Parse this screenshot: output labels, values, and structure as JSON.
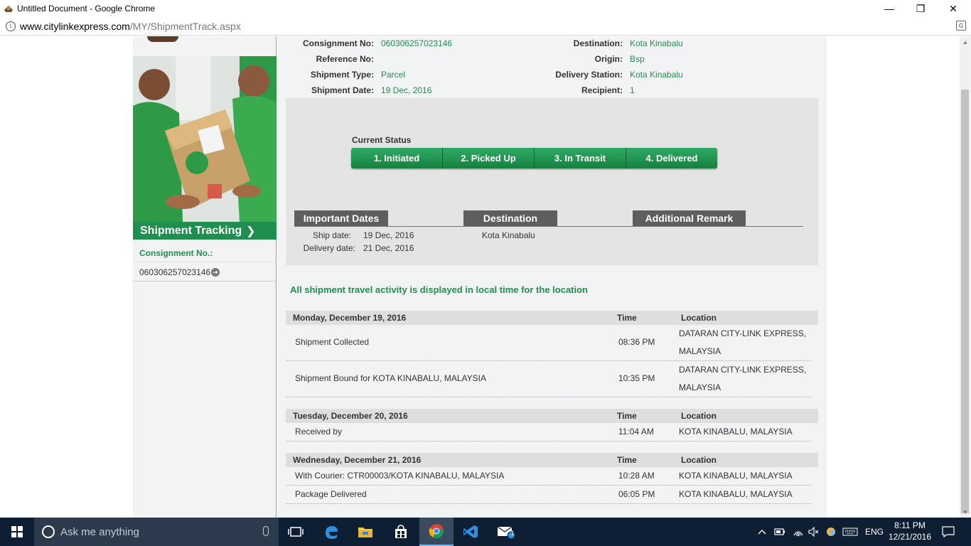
{
  "window": {
    "title": "Untitled Document - Google Chrome",
    "url_host": "www.citylinkexpress.com",
    "url_path": "/MY/ShipmentTrack.aspx"
  },
  "sidebar": {
    "banner_label": "Shipment Tracking",
    "consignment_label": "Consignment No.:",
    "consignment_value": "060306257023146"
  },
  "shipment": {
    "consignment_label": "Consignment No:",
    "consignment_value": "060306257023146",
    "reference_label": "Reference No:",
    "reference_value": "",
    "type_label": "Shipment Type:",
    "type_value": "Parcel",
    "date_label": "Shipment Date:",
    "date_value": "19 Dec, 2016",
    "destination_label": "Destination:",
    "destination_value": "Kota Kinabalu",
    "origin_label": "Origin:",
    "origin_value": "Bsp",
    "station_label": "Delivery Station:",
    "station_value": "Kota Kinabalu",
    "recipient_label": "Recipient:",
    "recipient_value": "1"
  },
  "status": {
    "heading": "Current Status",
    "steps": [
      "1. Initiated",
      "2. Picked Up",
      "3. In Transit",
      "4. Delivered"
    ]
  },
  "details": {
    "important_dates_header": "Important Dates",
    "destination_header": "Destination",
    "remark_header": "Additional Remark",
    "ship_date_label": "Ship date:",
    "ship_date_value": "19 Dec, 2016",
    "delivery_date_label": "Delivery date:",
    "delivery_date_value": "21 Dec, 2016",
    "destination_value": "Kota Kinabalu"
  },
  "activity": {
    "notice": "All shipment travel activity is displayed in local time for the location",
    "time_header": "Time",
    "location_header": "Location",
    "days": [
      {
        "date": "Monday, December 19, 2016",
        "events": [
          {
            "desc": "Shipment Collected",
            "time": "08:36 PM",
            "loc1": "DATARAN CITY-LINK EXPRESS,",
            "loc2": "MALAYSIA"
          },
          {
            "desc": "Shipment Bound for KOTA KINABALU, MALAYSIA",
            "time": "10:35 PM",
            "loc1": "DATARAN CITY-LINK EXPRESS,",
            "loc2": "MALAYSIA"
          }
        ]
      },
      {
        "date": "Tuesday, December 20, 2016",
        "events": [
          {
            "desc": "Received by",
            "time": "11:04 AM",
            "loc1": "KOTA KINABALU, MALAYSIA"
          }
        ]
      },
      {
        "date": "Wednesday, December 21, 2016",
        "events": [
          {
            "desc": "With Courier: CTR00003/KOTA KINABALU, MALAYSIA",
            "time": "10:28 AM",
            "loc1": "KOTA KINABALU, MALAYSIA"
          },
          {
            "desc": "Package Delivered",
            "time": "06:05 PM",
            "loc1": "KOTA KINABALU, MALAYSIA"
          }
        ]
      }
    ]
  },
  "taskbar": {
    "search_placeholder": "Ask me anything",
    "language": "ENG",
    "time": "8:11 PM",
    "date": "12/21/2016",
    "mail_badge": "1"
  },
  "colors": {
    "brand_green": "#1e8f4e",
    "tab_gray": "#5e5e5e",
    "taskbar": "#0f1f33"
  }
}
